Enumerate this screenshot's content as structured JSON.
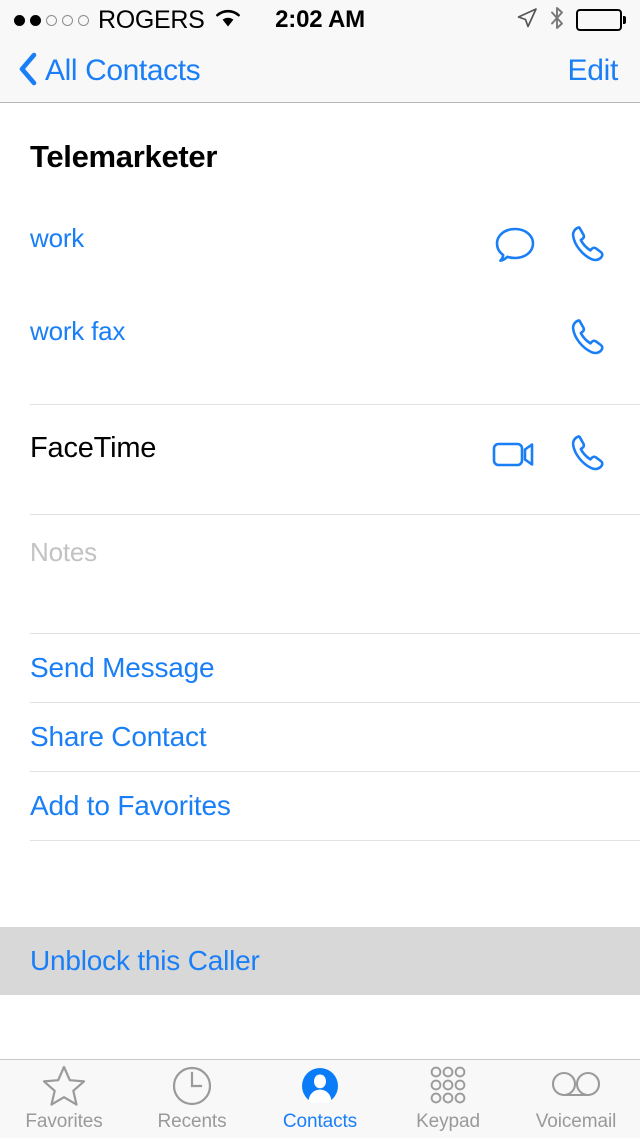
{
  "status_bar": {
    "carrier": "ROGERS",
    "signal_bars_filled": 2,
    "signal_bars_total": 5,
    "wifi_icon": "wifi-icon",
    "time": "2:02 AM",
    "location_icon": "location-arrow-icon",
    "bluetooth_icon": "bluetooth-icon",
    "battery_icon": "battery-full-icon",
    "battery_level_percent": 100
  },
  "nav_bar": {
    "back_icon": "chevron-left-icon",
    "back_label": "All Contacts",
    "edit_label": "Edit"
  },
  "contact": {
    "name": "Telemarketer",
    "fields": [
      {
        "label": "work",
        "style": "link",
        "actions": [
          "message-bubble-icon",
          "phone-handset-icon"
        ]
      },
      {
        "label": "work fax",
        "style": "link",
        "actions": [
          "phone-handset-icon"
        ]
      }
    ],
    "facetime": {
      "label": "FaceTime",
      "style": "dark",
      "actions": [
        "video-camera-icon",
        "phone-handset-icon"
      ]
    },
    "notes": {
      "placeholder": "Notes",
      "value": ""
    }
  },
  "actions": [
    {
      "label": "Send Message"
    },
    {
      "label": "Share Contact"
    },
    {
      "label": "Add to Favorites"
    }
  ],
  "block_action": {
    "label": "Unblock this Caller",
    "highlighted": true
  },
  "tab_bar": {
    "items": [
      {
        "label": "Favorites",
        "icon": "star-icon",
        "active": false
      },
      {
        "label": "Recents",
        "icon": "clock-icon",
        "active": false
      },
      {
        "label": "Contacts",
        "icon": "person-circle-icon",
        "active": true
      },
      {
        "label": "Keypad",
        "icon": "keypad-grid-icon",
        "active": false
      },
      {
        "label": "Voicemail",
        "icon": "voicemail-icon",
        "active": false
      }
    ]
  },
  "colors": {
    "accent_blue": "#1a7ff7",
    "text_black": "#000000",
    "placeholder_gray": "#c2c2c2",
    "divider_gray": "#e2e2e2",
    "bar_background": "#f8f8f8",
    "highlight_gray": "#d8d8d8",
    "inactive_tab_gray": "#9a9a9a"
  }
}
